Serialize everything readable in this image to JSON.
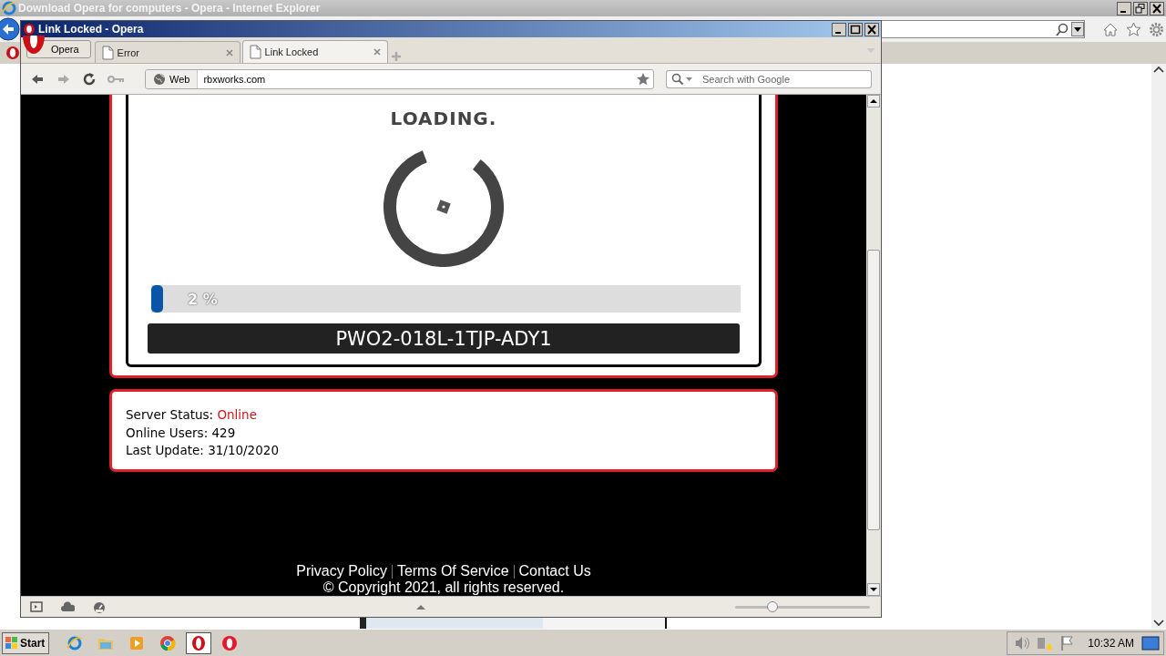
{
  "background_window": {
    "title": "Download Opera for computers - Opera - Internet Explorer"
  },
  "opera_window": {
    "title": "Link Locked - Opera",
    "menu_button": "Opera",
    "tabs": [
      {
        "label": "Error",
        "selected": false
      },
      {
        "label": "Link Locked",
        "selected": true
      }
    ],
    "address_bar": {
      "badge": "Web",
      "url": "rbxworks.com"
    },
    "search": {
      "placeholder": "Search with Google"
    },
    "page": {
      "loading_title": "LOADING.",
      "progress": {
        "level": 0.02,
        "reading": "2 %"
      },
      "code": "PWO2-018L-1TJP-ADY1",
      "status": [
        {
          "label": "Server Status:",
          "value": "Online",
          "kind": "status"
        },
        {
          "label": "Online Users:",
          "value": "429",
          "kind": "plain"
        },
        {
          "label": "Last Update:",
          "value": "31/10/2020",
          "kind": "plain"
        }
      ],
      "footer_links": [
        "Privacy Policy",
        "Terms Of Service",
        "Contact Us"
      ],
      "copyright": "© Copyright 2021, all rights reserved."
    },
    "zoom": {
      "level": 0.28
    }
  },
  "taskbar": {
    "start": "Start",
    "clock": "10:32 AM"
  }
}
